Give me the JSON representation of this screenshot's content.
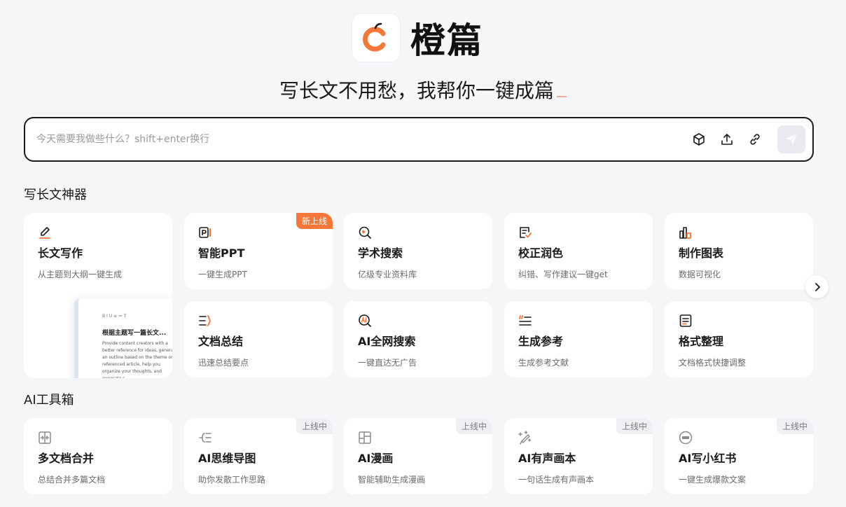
{
  "brand": {
    "name": "橙篇",
    "accent": "#f47738"
  },
  "slogan": "写长文不用愁，我帮你一键成篇",
  "search": {
    "placeholder": "今天需要我做些什么？shift+enter换行"
  },
  "sections": {
    "writing": "写长文神器",
    "tools": "AI工具箱"
  },
  "preview": {
    "toolbar": "B I U ≡ ≔ T",
    "heading": "根据主题写一篇长文...",
    "body": "Provide content creators with a better reference for ideas, generate an outline based on the theme or referenced article, help you organize your thoughts, and generate c"
  },
  "writing_cards": [
    {
      "title": "长文写作",
      "desc": "从主题到大纲一键生成",
      "icon": "pen-icon"
    },
    {
      "title": "智能PPT",
      "desc": "一键生成PPT",
      "icon": "ppt-icon",
      "badge": "新上线"
    },
    {
      "title": "学术搜索",
      "desc": "亿级专业资料库",
      "icon": "academic-search-icon"
    },
    {
      "title": "校正润色",
      "desc": "纠错、写作建议一键get",
      "icon": "proofread-icon"
    },
    {
      "title": "制作图表",
      "desc": "数据可视化",
      "icon": "chart-icon"
    },
    {
      "title": "文档总结",
      "desc": "迅速总结要点",
      "icon": "summary-icon"
    },
    {
      "title": "AI全网搜索",
      "desc": "一键直达无广告",
      "icon": "ai-search-icon"
    },
    {
      "title": "生成参考",
      "desc": "生成参考文献",
      "icon": "quote-icon"
    },
    {
      "title": "格式整理",
      "desc": "文档格式快捷调整",
      "icon": "format-icon"
    }
  ],
  "tool_cards": [
    {
      "title": "多文档合并",
      "desc": "总结合并多篇文档",
      "icon": "merge-icon"
    },
    {
      "title": "AI思维导图",
      "desc": "助你发散工作思路",
      "icon": "mindmap-icon",
      "badge": "上线中"
    },
    {
      "title": "AI漫画",
      "desc": "智能辅助生成漫画",
      "icon": "comic-icon",
      "badge": "上线中"
    },
    {
      "title": "AI有声画本",
      "desc": "一句话生成有声画本",
      "icon": "audiobook-icon",
      "badge": "上线中"
    },
    {
      "title": "AI写小红书",
      "desc": "一键生成爆款文案",
      "icon": "xiaohongshu-icon",
      "badge": "上线中"
    }
  ]
}
